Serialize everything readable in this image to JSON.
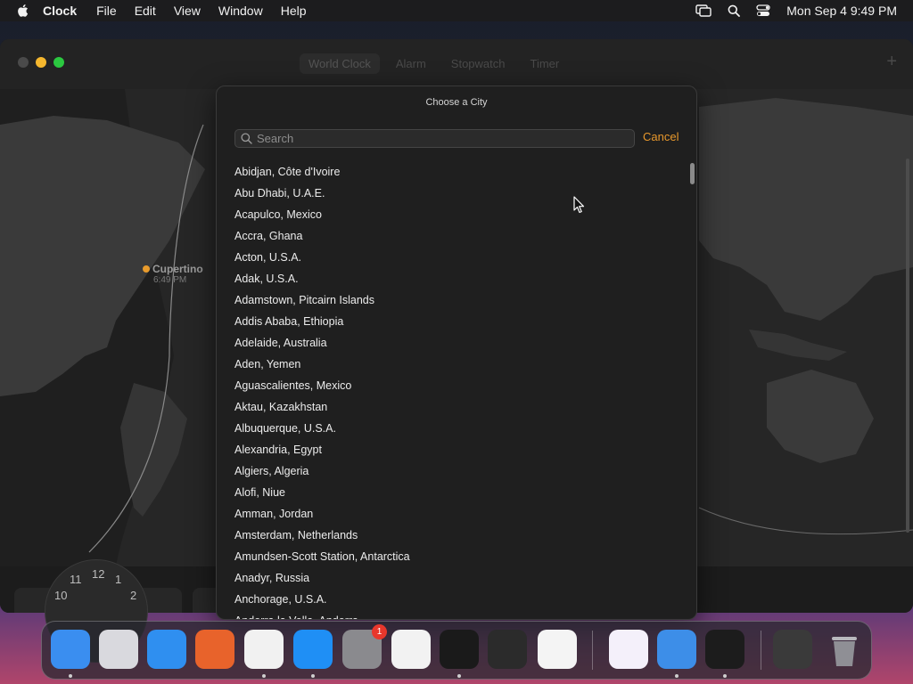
{
  "menubar": {
    "app_name": "Clock",
    "menus": [
      "File",
      "Edit",
      "View",
      "Window",
      "Help"
    ],
    "datetime": "Mon Sep 4  9:49 PM"
  },
  "window": {
    "tabs": [
      "World Clock",
      "Alarm",
      "Stopwatch",
      "Timer"
    ],
    "city": {
      "name": "Cupertino",
      "time": "6:49 PM"
    },
    "analog_numbers": [
      "11",
      "12",
      "1",
      "10",
      "2"
    ]
  },
  "sheet": {
    "title": "Choose a City",
    "search_placeholder": "Search",
    "cancel_label": "Cancel",
    "cities": [
      "Abidjan, Côte d'Ivoire",
      "Abu Dhabi, U.A.E.",
      "Acapulco, Mexico",
      "Accra, Ghana",
      "Acton, U.S.A.",
      "Adak, U.S.A.",
      "Adamstown, Pitcairn Islands",
      "Addis Ababa, Ethiopia",
      "Adelaide, Australia",
      "Aden, Yemen",
      "Aguascalientes, Mexico",
      "Aktau, Kazakhstan",
      "Albuquerque, U.S.A.",
      "Alexandria, Egypt",
      "Algiers, Algeria",
      "Alofi, Niue",
      "Amman, Jordan",
      "Amsterdam, Netherlands",
      "Amundsen-Scott Station, Antarctica",
      "Anadyr, Russia",
      "Anchorage, U.S.A.",
      "Andorra la Vella, Andorra"
    ]
  },
  "dock": {
    "settings_badge": "1",
    "apps": [
      {
        "name": "finder",
        "color": "#3a8ef0"
      },
      {
        "name": "launchpad",
        "color": "#d9d9de"
      },
      {
        "name": "safari",
        "color": "#2f8ff0"
      },
      {
        "name": "firefox",
        "color": "#e8632b"
      },
      {
        "name": "chrome",
        "color": "#f1f1f1"
      },
      {
        "name": "app-store",
        "color": "#1f8ff5"
      },
      {
        "name": "system-settings",
        "color": "#8a8a8e"
      },
      {
        "name": "textedit",
        "color": "#f2f2f2"
      },
      {
        "name": "terminal",
        "color": "#1a1a1a"
      },
      {
        "name": "garageband",
        "color": "#2b2b2b"
      },
      {
        "name": "vscode",
        "color": "#f4f4f4"
      },
      {
        "name": "visual-studio",
        "color": "#f4f0fa"
      },
      {
        "name": "weather",
        "color": "#3d8ee8"
      },
      {
        "name": "clock",
        "color": "#1c1c1c"
      },
      {
        "name": "screenshot-preview",
        "color": "#3a3a3a"
      },
      {
        "name": "trash",
        "color": "#9a9aa0"
      }
    ]
  },
  "colors": {
    "accent": "#e8982c",
    "sheet_bg": "#1f1f1f"
  }
}
